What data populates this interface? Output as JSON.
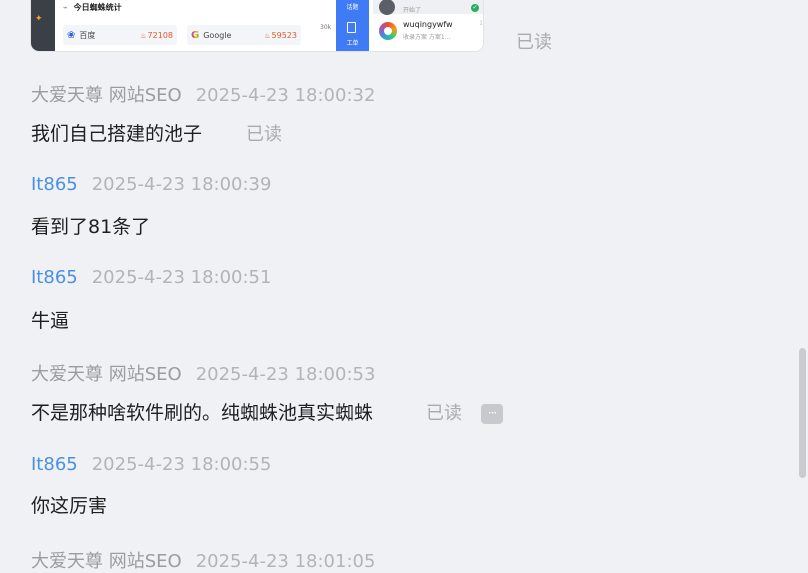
{
  "embedded_image": {
    "stats_title": "今日蜘蛛统计",
    "stats": [
      {
        "engine": "百度",
        "count": "72108"
      },
      {
        "engine": "Google",
        "count": "59523"
      }
    ],
    "axis_tick": "30k",
    "nav_labels": [
      "话题",
      "工单"
    ],
    "contacts": [
      {
        "name": "",
        "subtitle": "开始了"
      },
      {
        "name": "wuqingywfw",
        "subtitle": "收录方案 方案1...",
        "count": "1"
      }
    ]
  },
  "messages": [
    {
      "sender": "",
      "time": "",
      "content": "",
      "read": "已读"
    },
    {
      "sender": "大爱天尊 网站SEO",
      "time": "2025-4-23 18:00:32",
      "content": "我们自己搭建的池子",
      "read": "已读"
    },
    {
      "sender": "It865",
      "time": "2025-4-23 18:00:39",
      "content": "看到了81条了"
    },
    {
      "sender": "It865",
      "time": "2025-4-23 18:00:51",
      "content": "牛逼"
    },
    {
      "sender": "大爱天尊 网站SEO",
      "time": "2025-4-23 18:00:53",
      "content": "不是那种啥软件刷的。纯蜘蛛池真实蜘蛛",
      "read": "已读"
    },
    {
      "sender": "It865",
      "time": "2025-4-23 18:00:55",
      "content": "你这厉害"
    },
    {
      "sender": "大爱天尊 网站SEO",
      "time": "2025-4-23 18:01:05"
    }
  ],
  "more_button": "···",
  "colors": {
    "background": "#f0f1f5",
    "self_name": "#9a9ca3",
    "other_name": "#4a90e2",
    "accent": "#3f7bf5"
  }
}
